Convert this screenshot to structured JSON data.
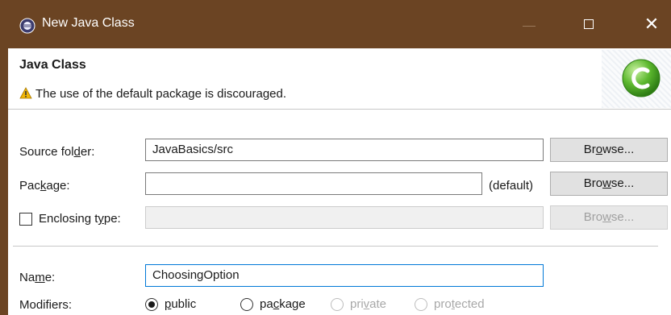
{
  "window": {
    "title": "New Java Class",
    "close_glyph": "✕"
  },
  "banner": {
    "heading": "Java Class",
    "warning": "The use of the default package is discouraged."
  },
  "source_folder": {
    "label_pre": "Source fol",
    "label_mnemonic": "d",
    "label_post": "er:",
    "value": "JavaBasics/src",
    "browse_pre": "Br",
    "browse_mnemonic": "o",
    "browse_post": "wse..."
  },
  "package": {
    "label_pre": "Pac",
    "label_mnemonic": "k",
    "label_post": "age:",
    "value": "",
    "default_hint": "(default)",
    "browse_pre": "Bro",
    "browse_mnemonic": "w",
    "browse_post": "se..."
  },
  "enclosing": {
    "label_pre": "Enclosing t",
    "label_mnemonic": "y",
    "label_post": "pe:",
    "value": "",
    "browse_pre": "Bro",
    "browse_mnemonic": "w",
    "browse_post": "se..."
  },
  "name": {
    "label_pre": "Na",
    "label_mnemonic": "m",
    "label_post": "e:",
    "value": "ChoosingOption"
  },
  "modifiers": {
    "label": "Modifiers:",
    "options": [
      {
        "pre": "",
        "mnemonic": "p",
        "post": "ublic",
        "checked": true,
        "enabled": true
      },
      {
        "pre": "pa",
        "mnemonic": "c",
        "post": "kage",
        "checked": false,
        "enabled": true
      },
      {
        "pre": "pri",
        "mnemonic": "v",
        "post": "ate",
        "checked": false,
        "enabled": false
      },
      {
        "pre": "pro",
        "mnemonic": "t",
        "post": "ected",
        "checked": false,
        "enabled": false
      }
    ]
  },
  "colors": {
    "titlebar": "#6b4423",
    "accent": "#0078d7",
    "logo_green": "#5cb82e"
  }
}
